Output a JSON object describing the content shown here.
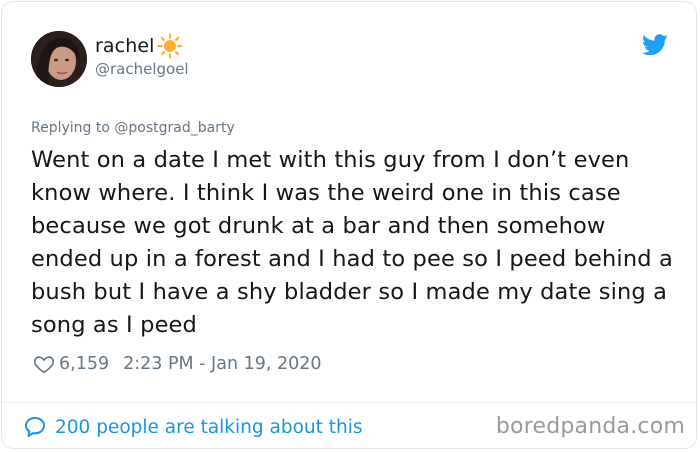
{
  "tweet": {
    "display_name": "rachel",
    "name_emoji_icon": "sun-emoji-icon",
    "handle": "@rachelgoel",
    "replying_prefix": "Replying to",
    "replying_to": "@postgrad_barty",
    "text": "Went on a date I met with this guy from I don’t even know where. I think I was the weird one in this case because we got drunk at a bar and then somehow ended up in a forest and I had to pee so I peed behind a bush but I have a shy bladder so I made my date sing a song as I peed",
    "likes": "6,159",
    "timestamp": "2:23 PM - Jan 19, 2020",
    "talking_label": "200 people are talking about this"
  },
  "icons": {
    "platform": "twitter-bird-icon",
    "like": "heart-outline-icon",
    "reply": "speech-bubble-icon"
  },
  "colors": {
    "accent": "#1da1f2",
    "link": "#1b95e0",
    "muted": "#657786",
    "text": "#14171a",
    "sun": "#ffac33"
  },
  "watermark": "boredpanda.com"
}
